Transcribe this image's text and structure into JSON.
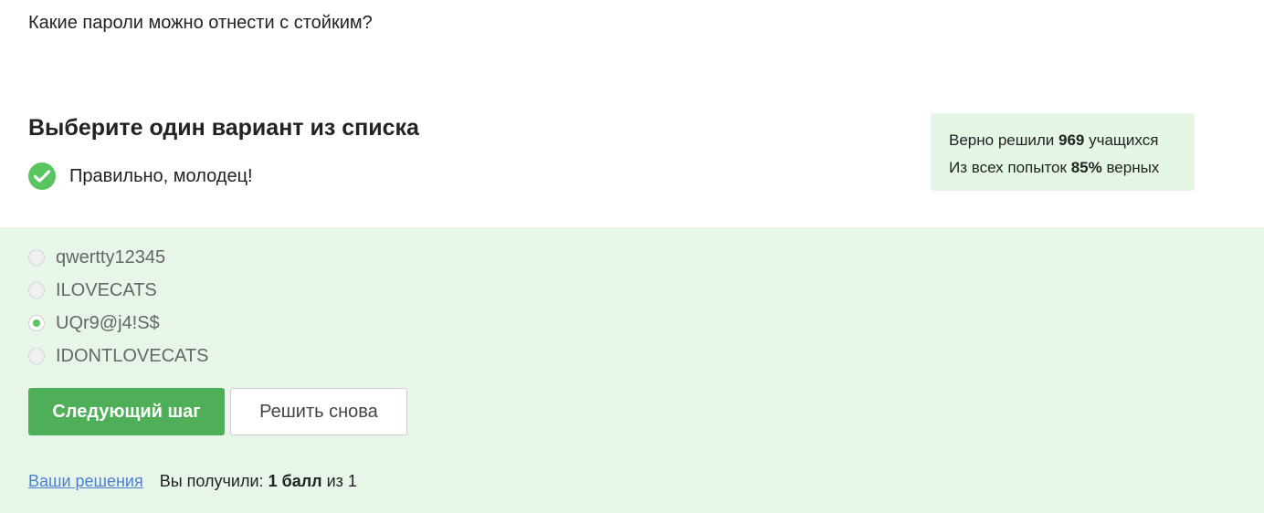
{
  "question": "Какие пароли можно отнести с стойким?",
  "prompt": "Выберите один вариант из списка",
  "feedback": {
    "text": "Правильно, молодец!",
    "icon": "checkmark-circle-icon",
    "color": "#59c561"
  },
  "stats": {
    "line1_prefix": "Верно решили",
    "solved_count": "969",
    "line1_suffix": "учащихся",
    "line2_prefix": "Из всех попыток",
    "percent": "85%",
    "line2_suffix": "верных"
  },
  "options": [
    {
      "label": "qwertty12345",
      "selected": false
    },
    {
      "label": "ILOVECATS",
      "selected": false
    },
    {
      "label": "UQr9@j4!S$",
      "selected": true
    },
    {
      "label": "IDONTLOVECATS",
      "selected": false
    }
  ],
  "buttons": {
    "next": "Следующий шаг",
    "retry": "Решить снова"
  },
  "footer": {
    "solutions_link": "Ваши решения",
    "score_prefix": "Вы получили:",
    "score_value": "1 балл",
    "score_suffix": "из 1"
  },
  "colors": {
    "accent": "#4fae58",
    "answer_bg": "#e7f6e9",
    "stats_bg": "#e4f7e6",
    "link": "#4a7fd1"
  }
}
